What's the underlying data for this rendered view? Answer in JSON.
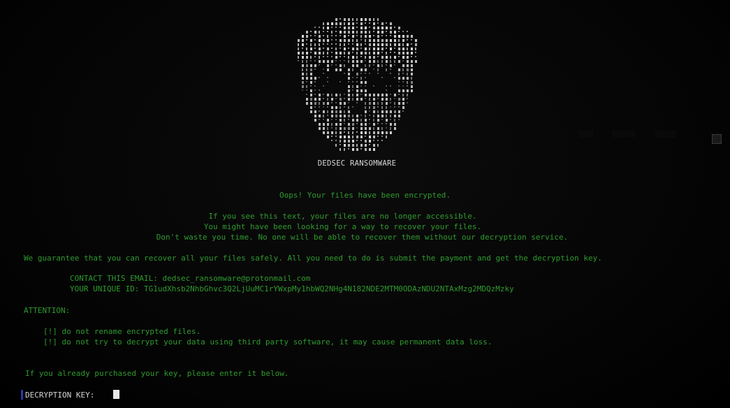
{
  "brand": "DEDSEC RANSOMWARE",
  "headline": "Oops! Your files have been encrypted.",
  "intro_lines": [
    "If you see this text, your files are no longer accessible.",
    "You might have been looking for a way to recover your files.",
    "Don't waste you time. No one will be able to recover them without our decryption service."
  ],
  "guarantee": "We guarantee that you can recover all your files safely. All you need to do is submit the payment and get the decryption key.",
  "contact": {
    "email_line": "CONTACT THIS EMAIL: dedsec_ransomware@protonmail.com",
    "id_line": "YOUR UNIQUE ID: TG1udXhsb2NhbGhvc3Q2LjUuMC1rYWxpMy1hbWQ2NHg4N182NDE2MTM0ODAzNDU2NTAxMzg2MDQzMzky"
  },
  "attention": {
    "heading": "ATTENTION:",
    "items": [
      "[!] do not rename encrypted files.",
      "[!] do not try to decrypt your data using third party software, it may cause permanent data loss."
    ]
  },
  "purchased_note": "If you already purchased your key, please enter it below.",
  "decryption": {
    "label": "DECRYPTION KEY:",
    "value": ""
  },
  "colors": {
    "text_green": "#2f9a2f",
    "text_white": "#d8d8d8",
    "background": "#050505",
    "prompt_marker": "#2a3aa8"
  },
  "icons": {
    "skull": "skull-ascii-art-icon",
    "cursor": "block-cursor-icon",
    "corner": "window-corner-icon"
  }
}
